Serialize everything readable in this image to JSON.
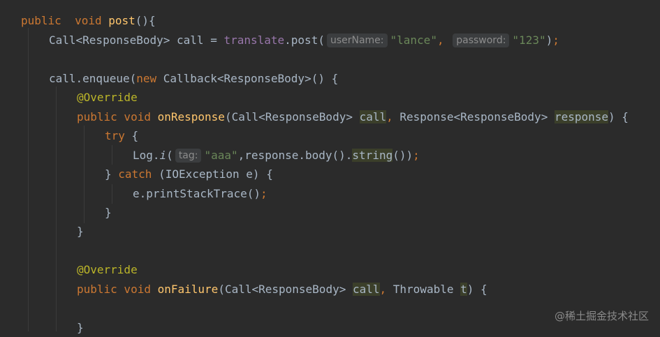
{
  "code": {
    "l1": {
      "kw_public": "public",
      "kw_void": "void",
      "method": "post",
      "rest": "(){"
    },
    "l2": {
      "t1": "Call<ResponseBody> call = ",
      "field": "translate",
      "t2": ".post(",
      "hint1": "userName:",
      "s1": "\"lance\"",
      "comma": ",",
      "hint2": "password:",
      "s2": "\"123\"",
      "close": ")",
      "semi": ";"
    },
    "l3": {
      "t1": "call.enqueue(",
      "kw_new": "new",
      "t2": " Callback<ResponseBody>() {"
    },
    "l4": {
      "ann": "@Override"
    },
    "l5": {
      "kw": "public void",
      "method": "onResponse",
      "t1": "(Call<ResponseBody> ",
      "p1": "call",
      "comma": ",",
      "t2": " Response<ResponseBody> ",
      "p2": "response",
      "t3": ") {"
    },
    "l6": {
      "kw": "try",
      "t1": " {"
    },
    "l7": {
      "t1": "Log.",
      "i": "i",
      "t2": "(",
      "hint": "tag:",
      "s1": "\"aaa\"",
      "t3": ",response.body().",
      "hl": "string",
      "t4": "())",
      "semi": ";"
    },
    "l8": {
      "t1": "} ",
      "kw": "catch",
      "t2": " (IOException e) {"
    },
    "l9": {
      "t1": "e.printStackTrace()",
      "semi": ";"
    },
    "l10": {
      "t1": "}"
    },
    "l11": {
      "t1": "}"
    },
    "l12": {
      "ann": "@Override"
    },
    "l13": {
      "kw": "public void",
      "method": "onFailure",
      "t1": "(Call<ResponseBody> ",
      "p1": "call",
      "comma": ",",
      "t2": " Throwable ",
      "p2": "t",
      "t3": ") {"
    },
    "l14": {
      "t1": "}"
    }
  },
  "watermark": "@稀土掘金技术社区",
  "colors": {
    "background": "#2b2b2b",
    "keyword": "#cc7832",
    "method": "#ffc66d",
    "string": "#6a8759",
    "annotation": "#bbb529",
    "field": "#9876aa",
    "text": "#a9b7c6"
  }
}
